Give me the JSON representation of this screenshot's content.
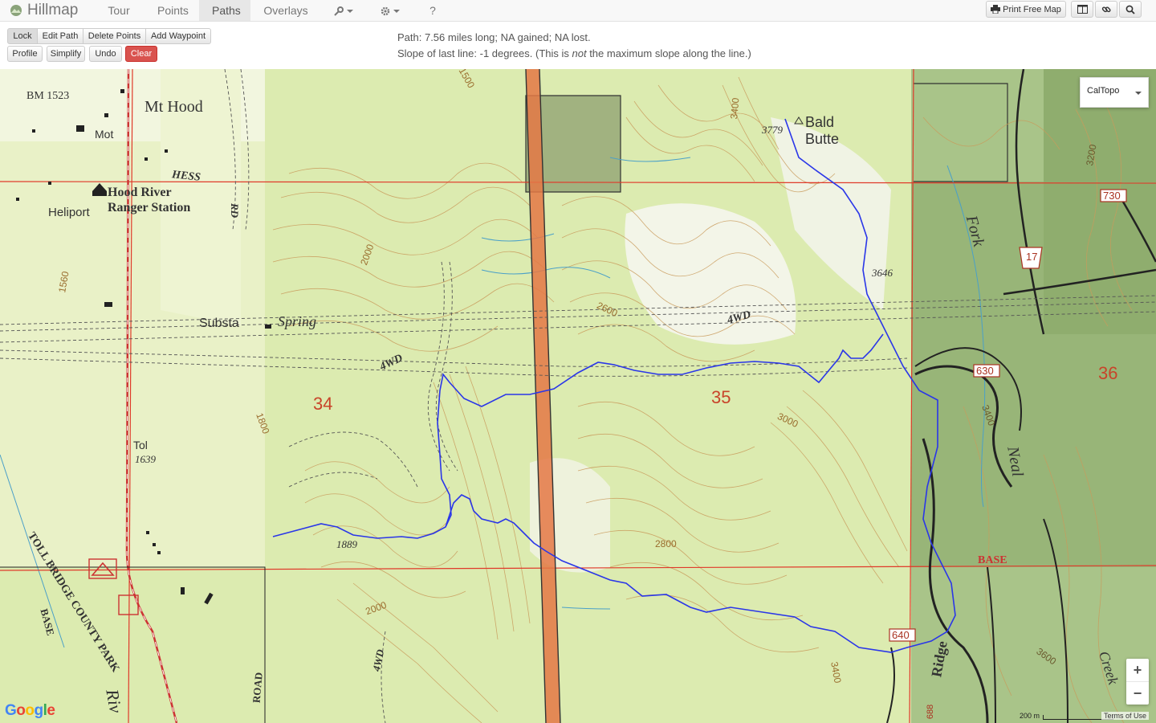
{
  "app": {
    "title": "Hillmap"
  },
  "nav": {
    "tabs": [
      {
        "label": "Tour"
      },
      {
        "label": "Points"
      },
      {
        "label": "Paths"
      },
      {
        "label": "Overlays"
      }
    ],
    "active_tab": "Paths",
    "tools_menu_icon": "wrench-icon",
    "settings_menu_icon": "gear-icon",
    "help_menu_label": "?",
    "print_label": "Print Free Map",
    "buttons_icons": [
      "print-icon",
      "split-view-icon",
      "link-icon",
      "search-icon"
    ]
  },
  "toolbar": {
    "lock": "Lock",
    "edit_path": "Edit Path",
    "delete_points": "Delete Points",
    "add_waypoint": "Add Waypoint",
    "profile": "Profile",
    "simplify": "Simplify",
    "undo": "Undo",
    "clear": "Clear"
  },
  "status": {
    "line1": "Path: 7.56 miles long; NA gained; NA lost.",
    "line2_prefix": "Slope of last line: -1 degrees. (This is ",
    "line2_em": "not",
    "line2_suffix": " the maximum slope along the line.)"
  },
  "map": {
    "layer_select": "CalTopo",
    "zoom_in": "+",
    "zoom_out": "−",
    "scale_label": "200 m",
    "terms": "Terms of Use",
    "google": "Google",
    "colors": {
      "route": "#2a36e8",
      "grid_line": "#e03a2a",
      "forest": "#8fb070",
      "contour": "#c79a5a",
      "highway": "#e47845"
    },
    "labels": {
      "bm": "BM 1523",
      "mt_hood": "Mt Hood",
      "mot": "Mot",
      "hess": "HESS",
      "hood_river": "Hood River",
      "ranger_station": "Ranger Station",
      "heliport": "Heliport",
      "rd": "RD",
      "substa": "Substa",
      "spring": "Spring",
      "fwd1": "4WD",
      "fwd2": "4WD",
      "fwd3": "4WD",
      "sec34": "34",
      "sec35": "35",
      "sec36": "36",
      "tol": "Tol",
      "tol_elev": "1639",
      "toll_bridge": "TOLL BRIDGE COUNTY PARK",
      "base1": "BASE",
      "base2": "BASE",
      "road": "ROAD",
      "riv": "Riv",
      "bald": "Bald",
      "butte": "Butte",
      "bald_elev": "3779",
      "elev_3646": "3646",
      "elev_1889": "1889",
      "fork": "Fork",
      "neal": "Neal",
      "creek": "Creek",
      "ridge": "Ridge",
      "r730": "730",
      "r17": "17",
      "r630": "630",
      "r640": "640",
      "r688": "688",
      "c1560": "1560",
      "c2000a": "2000",
      "c2000b": "2000",
      "c1800": "1800",
      "c2600": "2600",
      "c2800": "2800",
      "c3000": "3000",
      "c3400a": "3400",
      "c3400b": "3400",
      "c3200": "3200",
      "c3600": "3600",
      "c3400c": "3400",
      "c1500": "1500",
      "c3400d": "3400"
    }
  }
}
